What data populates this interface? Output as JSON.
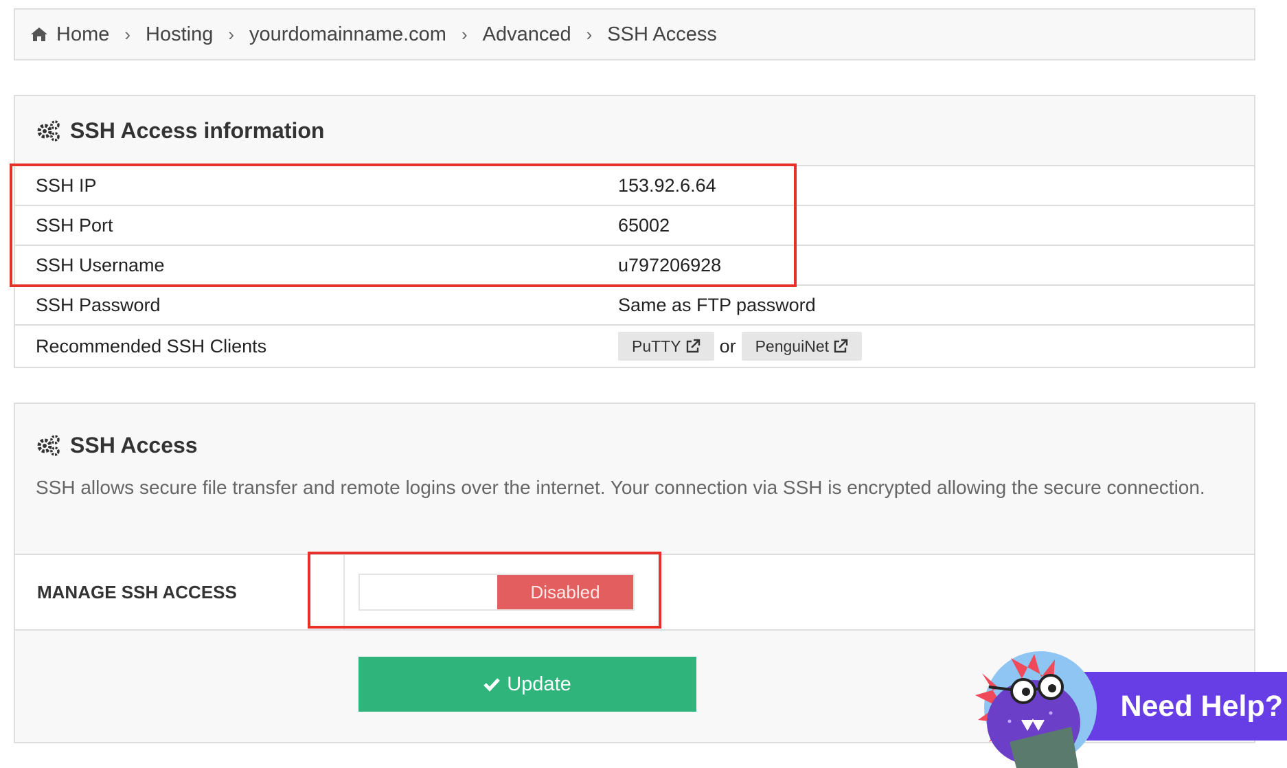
{
  "breadcrumb": {
    "items": [
      "Home",
      "Hosting",
      "yourdomainname.com",
      "Advanced",
      "SSH Access"
    ],
    "separator": "›"
  },
  "ssh_info": {
    "title": "SSH Access information",
    "rows": [
      {
        "label": "SSH IP",
        "value": "153.92.6.64"
      },
      {
        "label": "SSH Port",
        "value": "65002"
      },
      {
        "label": "SSH Username",
        "value": "u797206928"
      },
      {
        "label": "SSH Password",
        "value": "Same as FTP password"
      }
    ],
    "clients_label": "Recommended SSH Clients",
    "clients": [
      "PuTTY",
      "PenguiNet"
    ],
    "clients_separator": "or"
  },
  "ssh_access": {
    "title": "SSH Access",
    "description": "SSH allows secure file transfer and remote logins over the internet. Your connection via SSH is encrypted allowing the secure connection.",
    "manage_label": "MANAGE SSH ACCESS",
    "toggle_state": "Disabled",
    "update_label": "Update"
  },
  "help_widget": {
    "label": "Need Help?"
  },
  "colors": {
    "disabled": "#e35f5f",
    "update": "#2fb47c",
    "help": "#673de6",
    "highlight": "#e8302a"
  }
}
